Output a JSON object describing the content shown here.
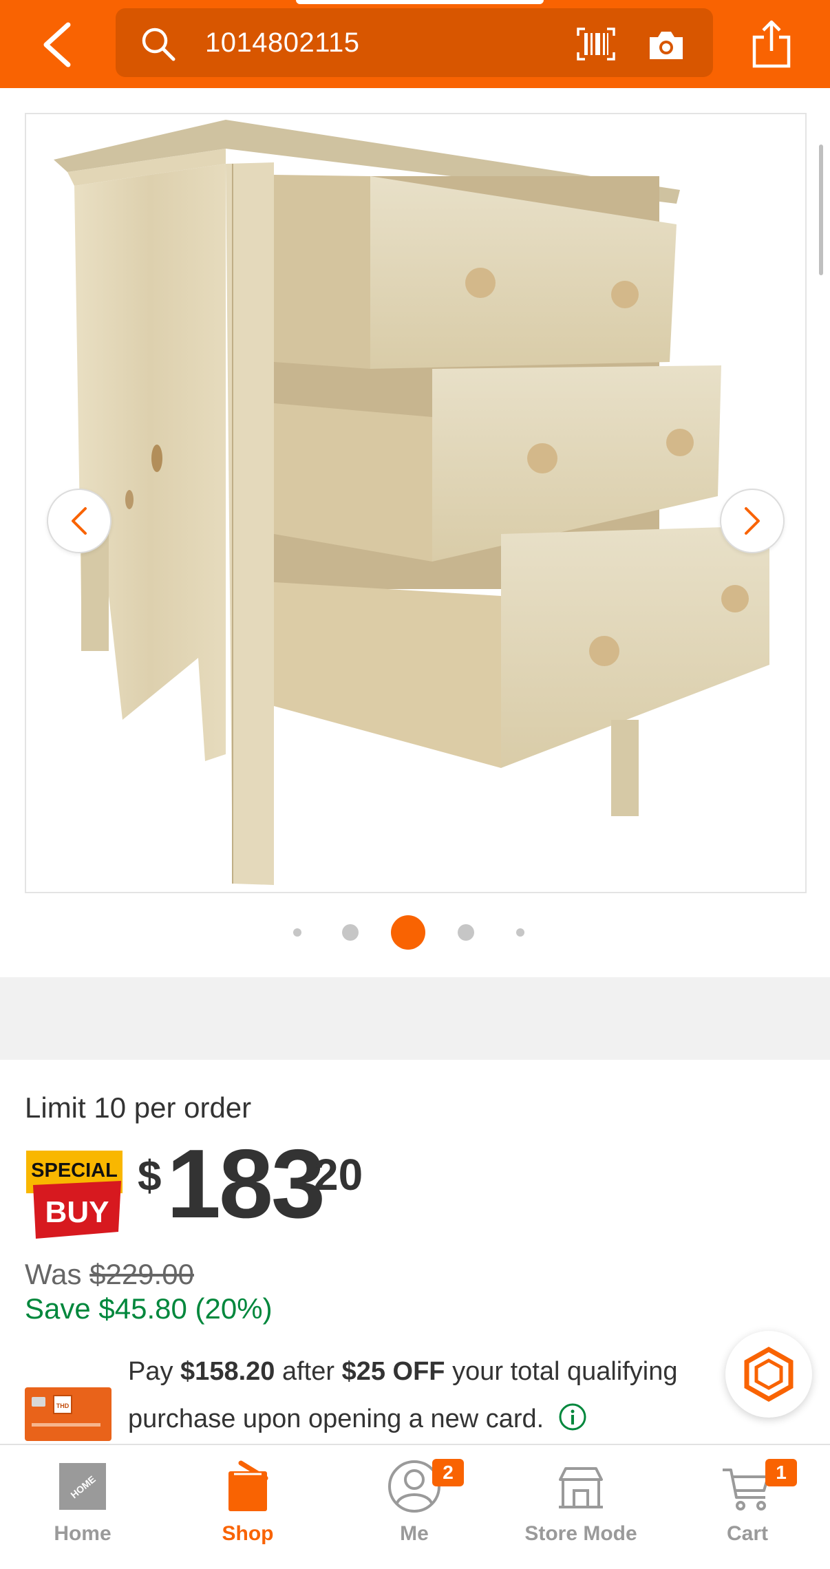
{
  "colors": {
    "brand": "#f96302",
    "search_bg": "#d85600",
    "save_green": "#00873c"
  },
  "header": {
    "search_query": "1014802115",
    "icons": [
      "back-arrow-icon",
      "search-icon",
      "barcode-icon",
      "camera-icon",
      "share-icon"
    ]
  },
  "carousel": {
    "image_alt_icon": "dresser-product-image",
    "total_dots": 5,
    "active_dot": 3
  },
  "pricing": {
    "limit": "Limit 10 per order",
    "badge_top": "SPECIAL",
    "badge_bottom": "BUY",
    "currency": "$",
    "dollars": "183",
    "cents": "20",
    "was_label": "Was",
    "was_price": "$229.00",
    "save_text": "Save $45.80 (20%)"
  },
  "promo": {
    "pay_prefix": "Pay ",
    "pay_amount": "$158.20",
    "after_text": " after ",
    "off_amount": "$25 OFF",
    "line1_suffix": " your total qualifying",
    "line2": "purchase upon opening a new card."
  },
  "bottom_nav": {
    "items": [
      {
        "label": "Home"
      },
      {
        "label": "Shop"
      },
      {
        "label": "Me",
        "badge": "2"
      },
      {
        "label": "Store Mode"
      },
      {
        "label": "Cart",
        "badge": "1"
      }
    ],
    "active": "Shop"
  }
}
